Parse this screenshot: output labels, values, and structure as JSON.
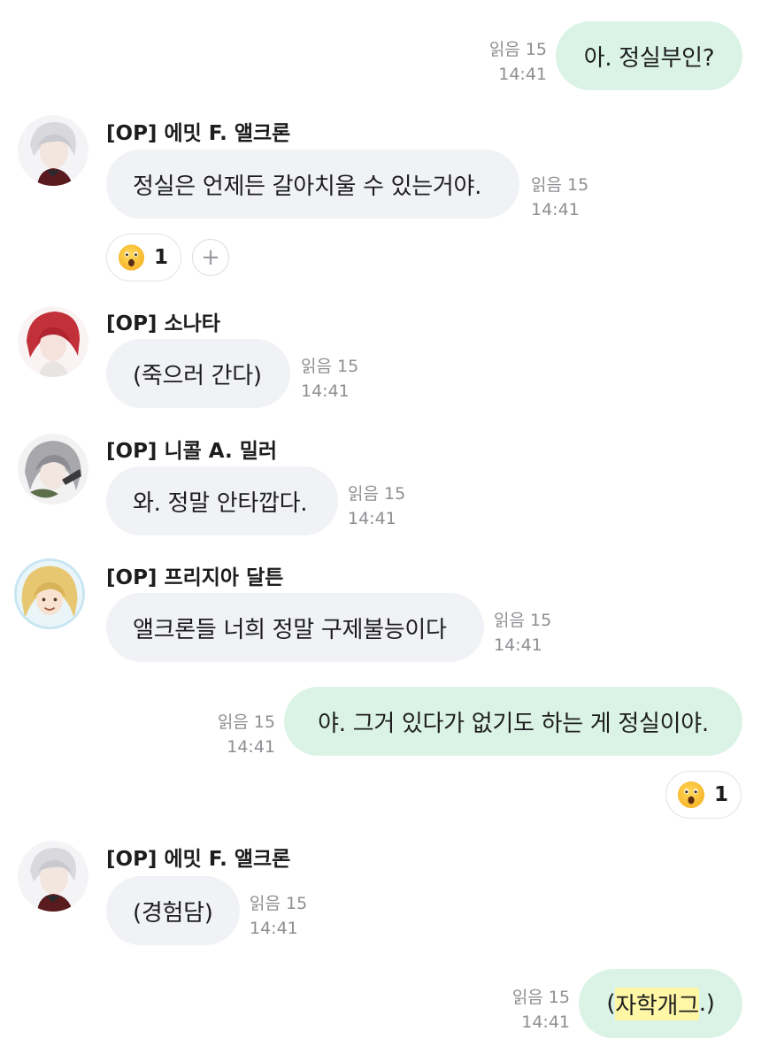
{
  "messages": [
    {
      "id": "m1",
      "direction": "out",
      "text": "아. 정실부인?",
      "read_label": "읽음 15",
      "time": "14:41"
    },
    {
      "id": "m2",
      "direction": "in",
      "sender": "[OP] 에밋 F. 앨크론",
      "avatar": "emmett-avatar",
      "text": "정실은 언제든 갈아치울 수 있는거야.",
      "read_label": "읽음 15",
      "time": "14:41",
      "reaction": {
        "emoji": "astonished-face",
        "count": "1",
        "add_symbol": "+"
      }
    },
    {
      "id": "m3",
      "direction": "in",
      "sender": "[OP] 소나타",
      "avatar": "sonata-avatar",
      "text": "(죽으러 간다)",
      "read_label": "읽음 15",
      "time": "14:41"
    },
    {
      "id": "m4",
      "direction": "in",
      "sender": "[OP] 니콜 A. 밀러",
      "avatar": "nicole-avatar",
      "text": "와. 정말 안타깝다.",
      "read_label": "읽음 15",
      "time": "14:41"
    },
    {
      "id": "m5",
      "direction": "in",
      "sender": "[OP] 프리지아 달튼",
      "avatar": "freesia-avatar",
      "text": "앨크론들 너희 정말 구제불능이다",
      "read_label": "읽음 15",
      "time": "14:41"
    },
    {
      "id": "m6",
      "direction": "out",
      "text": "야. 그거 있다가 없기도 하는 게 정실이야.",
      "read_label": "읽음 15",
      "time": "14:41",
      "reaction": {
        "emoji": "astonished-face",
        "count": "1"
      }
    },
    {
      "id": "m7",
      "direction": "in",
      "sender": "[OP] 에밋 F. 앨크론",
      "avatar": "emmett-avatar",
      "text": "(경험담)",
      "read_label": "읽음 15",
      "time": "14:41"
    },
    {
      "id": "m8",
      "direction": "out",
      "text_prefix": "(",
      "text_highlight": "자학개그",
      "text_suffix": ".)",
      "read_label": "읽음 15",
      "time": "14:41"
    }
  ],
  "colors": {
    "incoming_bubble": "#f1f2f5",
    "outgoing_bubble": "#dbf3e6",
    "meta_text": "#8e8e93",
    "highlight": "#fff7a6"
  }
}
